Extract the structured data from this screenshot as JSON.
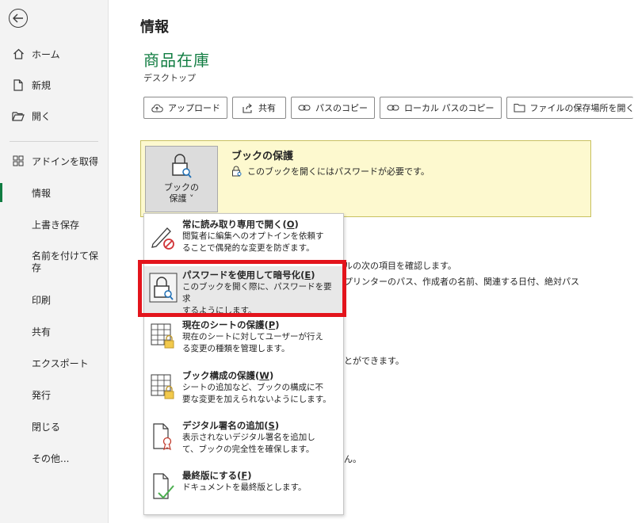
{
  "nav": {
    "items": [
      {
        "label": "ホーム",
        "icon": "home-icon"
      },
      {
        "label": "新規",
        "icon": "new-doc-icon"
      },
      {
        "label": "開く",
        "icon": "folder-open-icon"
      },
      {
        "label": "アドインを取得",
        "icon": "addins-grid-icon"
      },
      {
        "label": "情報",
        "selected": true
      },
      {
        "label": "上書き保存"
      },
      {
        "label": "名前を付けて保\n存"
      },
      {
        "label": "印刷"
      },
      {
        "label": "共有"
      },
      {
        "label": "エクスポート"
      },
      {
        "label": "発行"
      },
      {
        "label": "閉じる"
      },
      {
        "label": "その他..."
      }
    ]
  },
  "main": {
    "title": "情報",
    "doc_name": "商品在庫",
    "doc_location": "デスクトップ",
    "actions": [
      {
        "label": "アップロード",
        "icon": "upload-cloud-icon"
      },
      {
        "label": "共有",
        "icon": "share-icon"
      },
      {
        "label": "パスのコピー",
        "icon": "link-icon"
      },
      {
        "label": "ローカル パスのコピー",
        "icon": "link-icon"
      },
      {
        "label": "ファイルの保存場所を開く",
        "icon": "folder-icon"
      }
    ],
    "protect": {
      "button_line1": "ブックの",
      "button_line2": "保護 ˅",
      "heading": "ブックの保護",
      "description": "このブックを開くにはパスワードが必要です。"
    },
    "background_fragments": [
      "ルの次の項目を確認します。",
      "プリンターのパス、作成者の名前、関連する日付、絶対パス",
      "とができます。",
      "ん。"
    ]
  },
  "menu": {
    "items": [
      {
        "title": "常に読み取り専用で開く",
        "key": "O",
        "desc": "閲覧者に編集へのオプトインを依頼す\nることで偶発的な変更を防ぎます。",
        "icon": "pencil-no-icon"
      },
      {
        "title": "パスワードを使用して暗号化",
        "key": "E",
        "desc": "このブックを開く際に、パスワードを要求\nするようにします。",
        "icon": "lock-key-icon",
        "highlighted": true
      },
      {
        "title": "現在のシートの保護",
        "key": "P",
        "desc": "現在のシートに対してユーザーが行え\nる変更の種類を管理します。",
        "icon": "sheet-lock-icon"
      },
      {
        "title": "ブック構成の保護",
        "key": "W",
        "desc": "シートの追加など、ブックの構成に不\n要な変更を加えられないようにします。",
        "icon": "workbook-lock-icon"
      },
      {
        "title": "デジタル署名の追加",
        "key": "S",
        "desc": "表示されないデジタル署名を追加し\nて、ブックの完全性を確保します。",
        "icon": "signature-ribbon-icon"
      },
      {
        "title": "最終版にする",
        "key": "F",
        "desc": "ドキュメントを最終版とします。",
        "icon": "doc-check-icon"
      }
    ]
  },
  "colors": {
    "accent": "#107c41",
    "panel_bg": "#fdf9cf",
    "highlight_box": "#e3141c"
  }
}
